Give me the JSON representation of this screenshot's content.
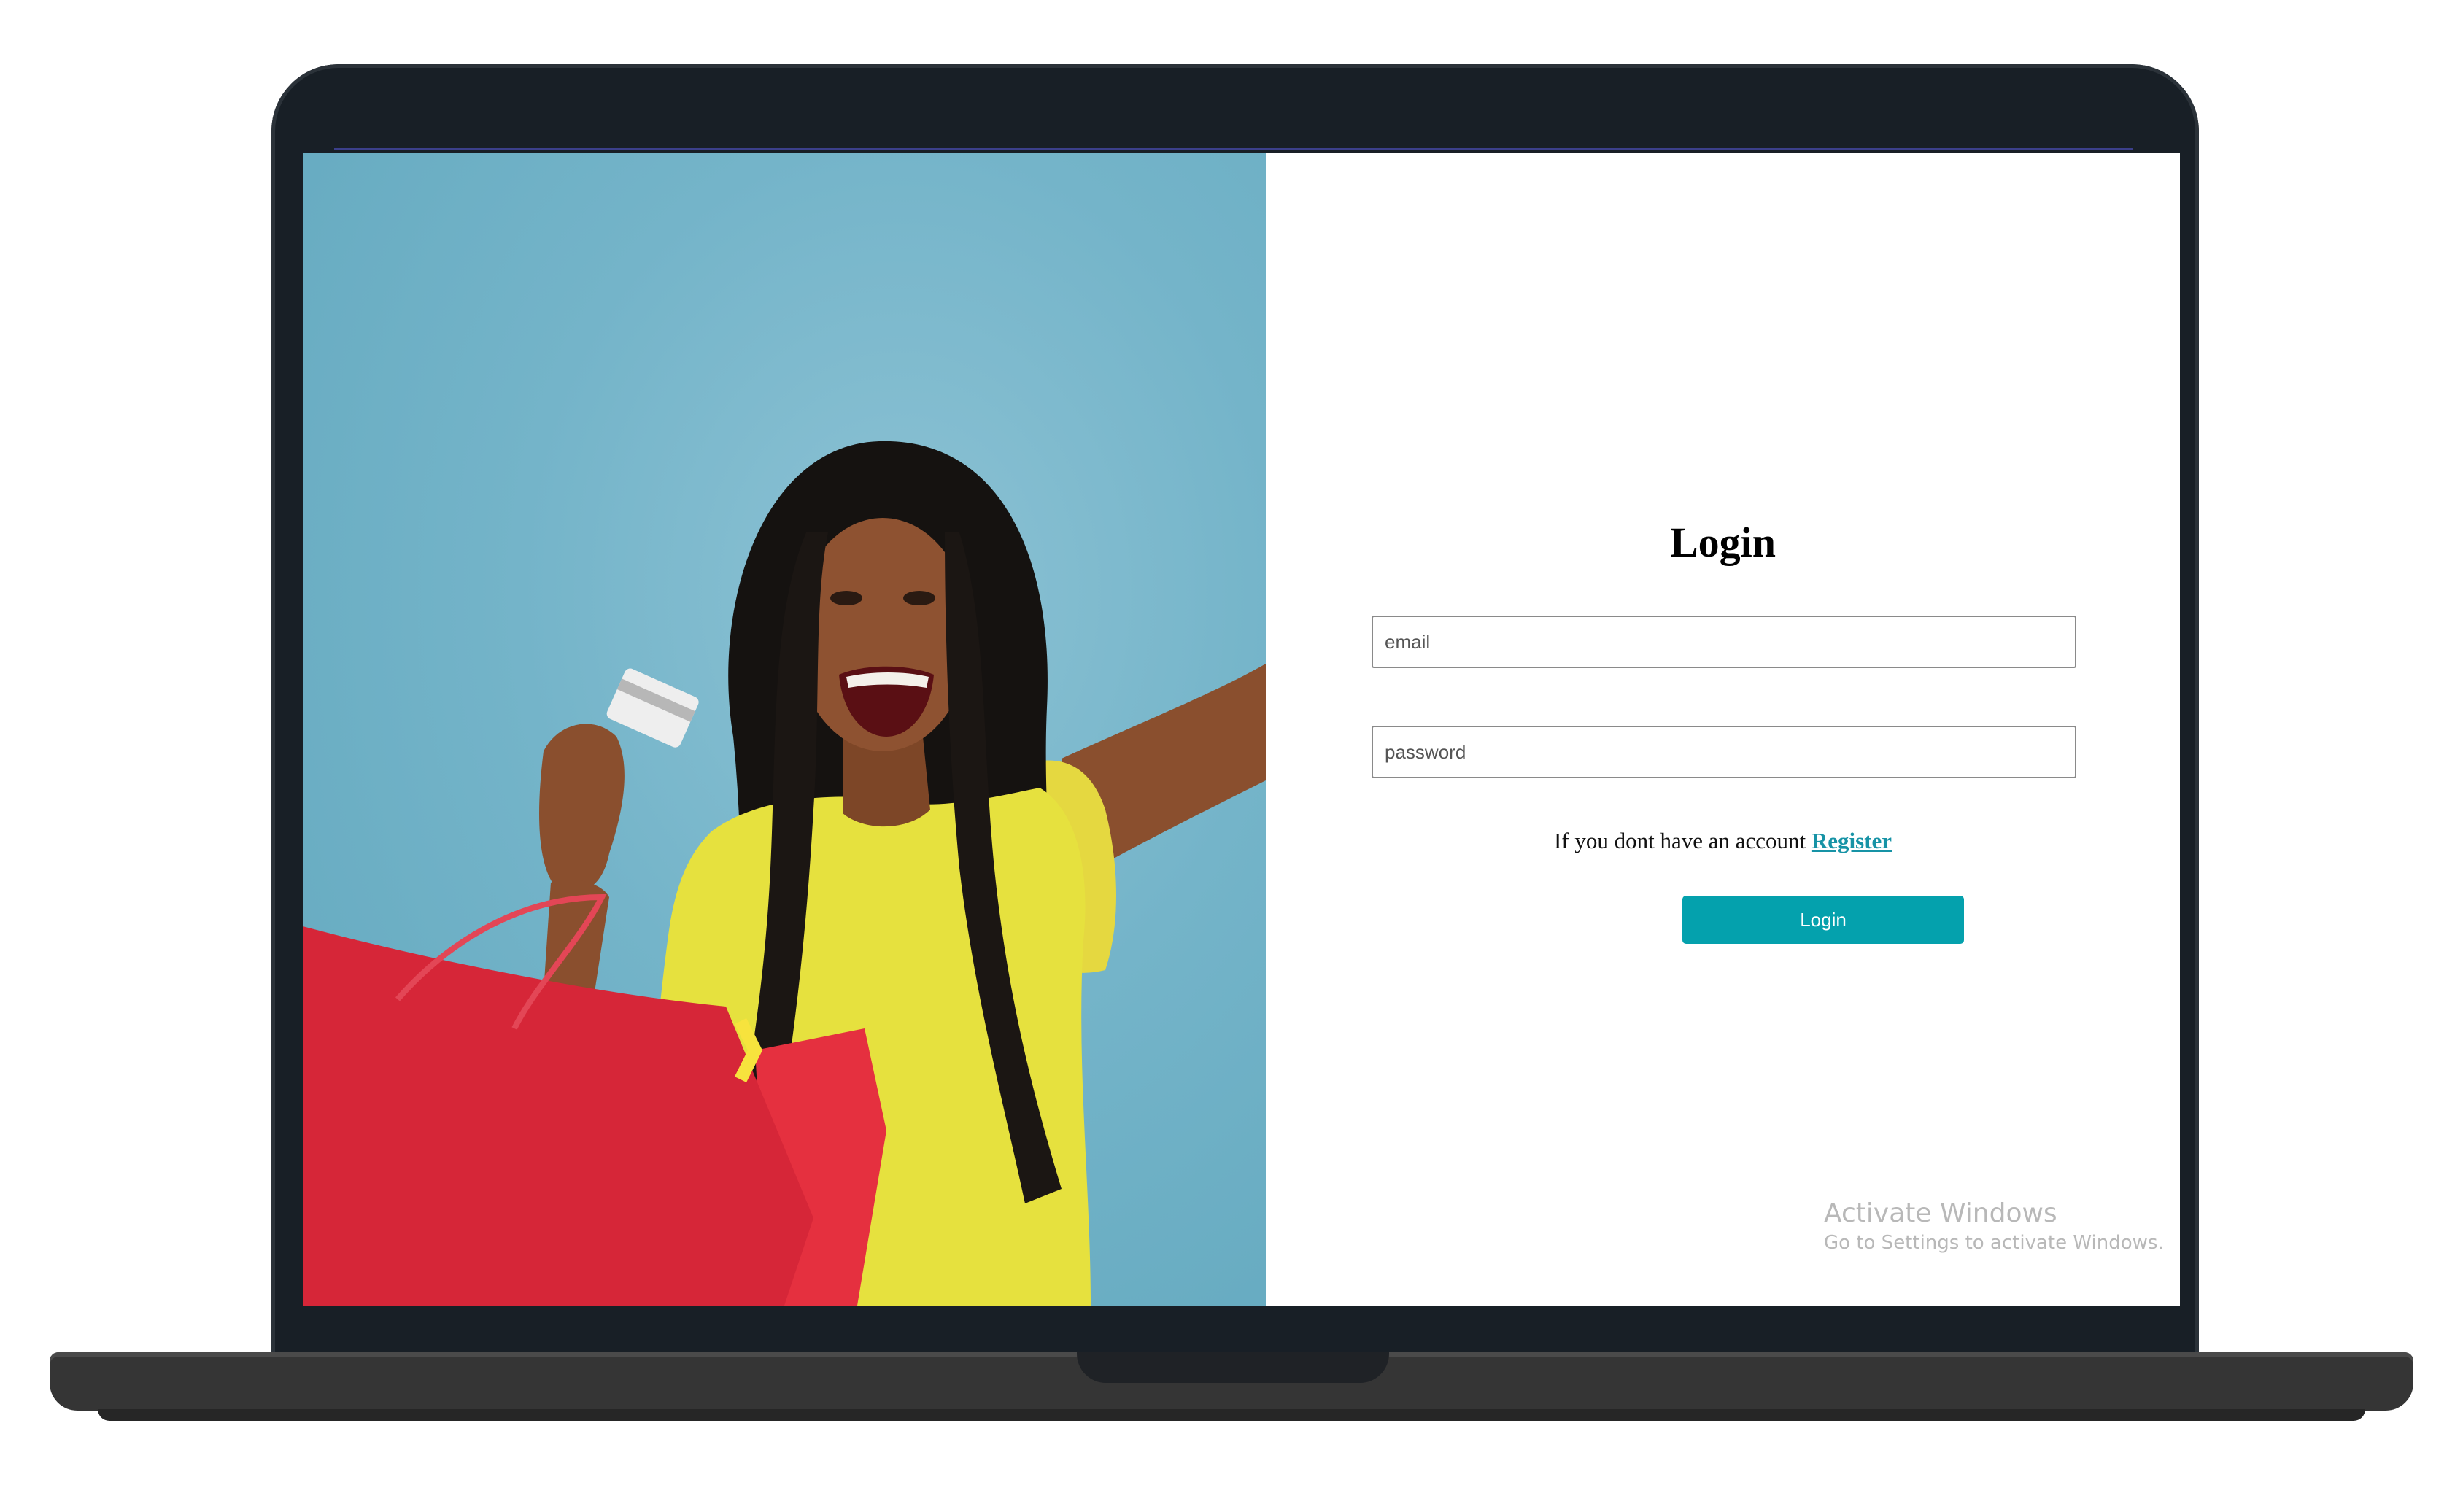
{
  "login": {
    "title": "Login",
    "email_placeholder": "email",
    "password_placeholder": "password",
    "register_prompt": "If you dont have an account",
    "register_link": "Register",
    "button_label": "Login"
  },
  "hero": {
    "image_description_icon": "shopping-woman-photo"
  },
  "watermark": {
    "title": "Activate Windows",
    "subtitle": "Go to Settings to activate Windows."
  },
  "colors": {
    "accent": "#04a1ad",
    "link": "#1793a6",
    "hero_background": "#74b4c9",
    "laptop_bezel": "#181f26"
  }
}
